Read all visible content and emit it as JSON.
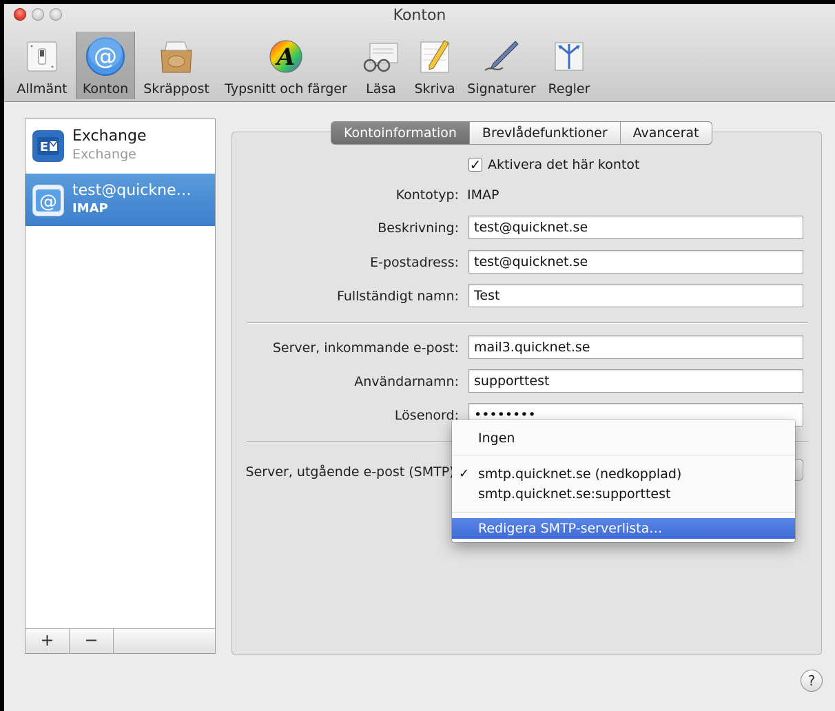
{
  "window": {
    "title": "Konton"
  },
  "toolbar": {
    "items": [
      {
        "label": "Allmänt",
        "icon": "light-switch-icon"
      },
      {
        "label": "Konton",
        "icon": "at-sign-icon",
        "selected": true
      },
      {
        "label": "Skräppost",
        "icon": "junk-mail-icon"
      },
      {
        "label": "Typsnitt och färger",
        "icon": "fonts-colors-icon"
      },
      {
        "label": "Läsa",
        "icon": "reading-glasses-icon"
      },
      {
        "label": "Skriva",
        "icon": "pencil-notepad-icon"
      },
      {
        "label": "Signaturer",
        "icon": "fountain-pen-icon"
      },
      {
        "label": "Regler",
        "icon": "rules-arrows-icon"
      }
    ]
  },
  "accounts": {
    "items": [
      {
        "name": "Exchange",
        "type": "Exchange",
        "icon": "exchange-icon"
      },
      {
        "name": "test@quickne…",
        "type": "IMAP",
        "icon": "at-sign-icon",
        "selected": true
      }
    ],
    "add_label": "+",
    "remove_label": "−"
  },
  "tabs": [
    {
      "label": "Kontoinformation",
      "active": true
    },
    {
      "label": "Brevlådefunktioner"
    },
    {
      "label": "Avancerat"
    }
  ],
  "form": {
    "enable_account_label": "Aktivera det här kontot",
    "enable_account_checked": true,
    "account_type_label": "Kontotyp:",
    "account_type_value": "IMAP",
    "description_label": "Beskrivning:",
    "description_value": "test@quicknet.se",
    "email_label": "E-postadress:",
    "email_value": "test@quicknet.se",
    "fullname_label": "Fullständigt namn:",
    "fullname_value": "Test",
    "incoming_label": "Server, inkommande e-post:",
    "incoming_value": "mail3.quicknet.se",
    "username_label": "Användarnamn:",
    "username_value": "supporttest",
    "password_label": "Lösenord:",
    "password_value": "••••••••",
    "outgoing_label": "Server, utgående e-post (SMTP):"
  },
  "smtp_menu": {
    "items": [
      {
        "label": "Ingen"
      },
      {
        "label": "smtp.quicknet.se (nedkopplad)",
        "checked": true,
        "check_mark": "✓"
      },
      {
        "label": "smtp.quicknet.se:supporttest"
      },
      {
        "label": "Redigera SMTP-serverlista…",
        "highlighted": true
      }
    ]
  },
  "help": {
    "label": "?"
  },
  "colors": {
    "selection_blue": "#3c7fcc",
    "menu_highlight": "#3d6ad8",
    "close_red": "#d8362a"
  }
}
